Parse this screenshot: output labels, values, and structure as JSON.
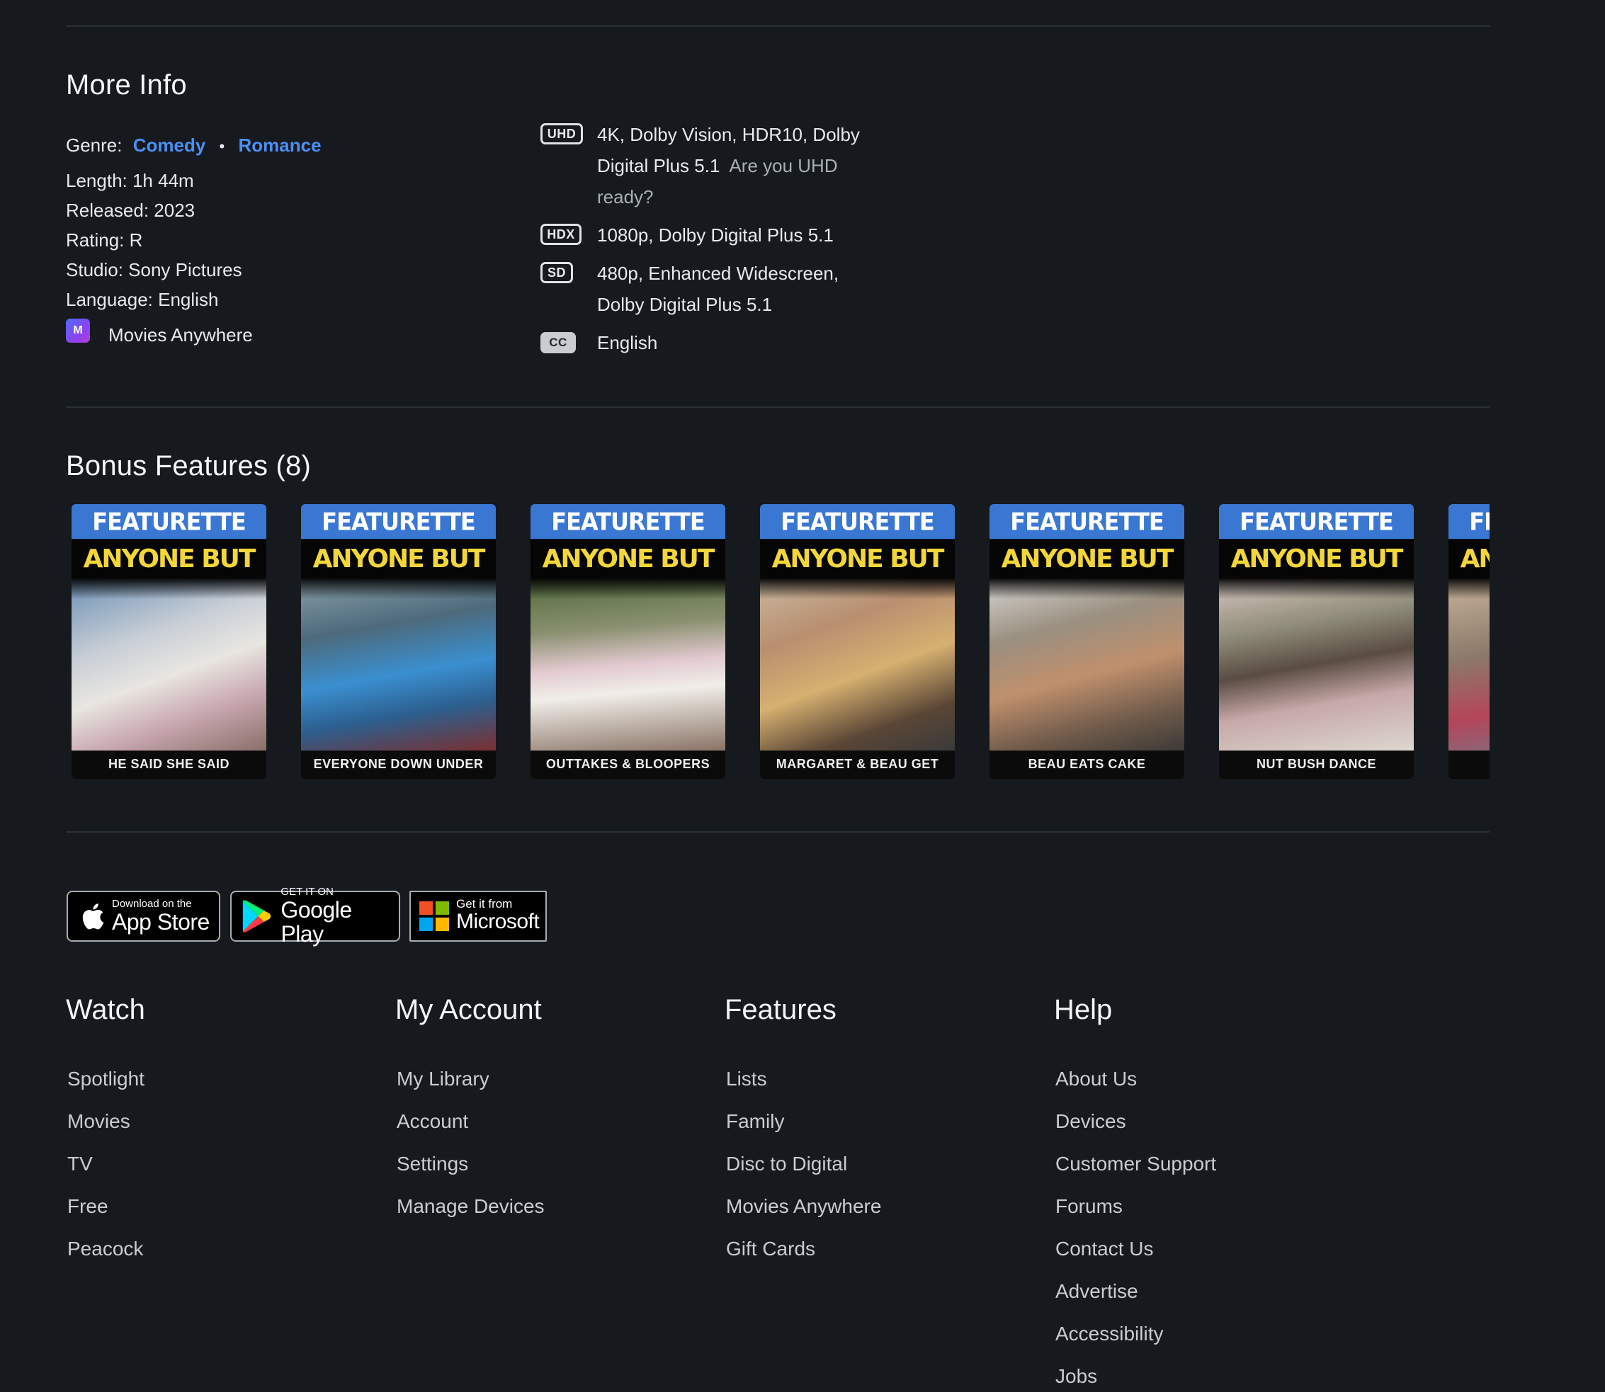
{
  "more_info": {
    "title": "More Info",
    "genre_label": "Genre:",
    "genres": [
      "Comedy",
      "Romance"
    ],
    "length": "Length: 1h 44m",
    "released": "Released: 2023",
    "rating": "Rating: R",
    "studio": "Studio: Sony Pictures",
    "language": "Language: English",
    "service_label": "Movies Anywhere",
    "service_icon_text": "M"
  },
  "formats": {
    "uhd_badge": "UHD",
    "uhd_line1": "4K, Dolby Vision, HDR10, Dolby",
    "uhd_line2": "Digital Plus 5.1",
    "uhd_link_a": "Are you UHD",
    "uhd_link_b": "ready?",
    "hdx_badge": "HDX",
    "hdx_text": "1080p, Dolby Digital Plus 5.1",
    "sd_badge": "SD",
    "sd_line1": "480p, Enhanced Widescreen,",
    "sd_line2": "Dolby Digital Plus 5.1",
    "cc_badge": "CC",
    "cc_text": "English"
  },
  "bonus": {
    "title": "Bonus Features (8)",
    "header_text": "FEATURETTE",
    "movie_text": "ANYONE BUT YOU",
    "cards": [
      {
        "caption": "HE SAID SHE SAID"
      },
      {
        "caption": "EVERYONE DOWN UNDER"
      },
      {
        "caption": "OUTTAKES & BLOOPERS"
      },
      {
        "caption": "MARGARET & BEAU GET READY"
      },
      {
        "caption": "BEAU EATS CAKE"
      },
      {
        "caption": "NUT BUSH DANCE"
      },
      {
        "caption": ""
      }
    ]
  },
  "stores": {
    "apple_small": "Download on the",
    "apple_big": "App Store",
    "google_small": "GET IT ON",
    "google_big": "Google Play",
    "ms_small": "Get it from",
    "ms_big": "Microsoft"
  },
  "footer": {
    "watch": {
      "title": "Watch",
      "items": [
        "Spotlight",
        "Movies",
        "TV",
        "Free",
        "Peacock"
      ]
    },
    "account": {
      "title": "My Account",
      "items": [
        "My Library",
        "Account",
        "Settings",
        "Manage Devices"
      ]
    },
    "features": {
      "title": "Features",
      "items": [
        "Lists",
        "Family",
        "Disc to Digital",
        "Movies Anywhere",
        "Gift Cards"
      ]
    },
    "help": {
      "title": "Help",
      "items": [
        "About Us",
        "Devices",
        "Customer Support",
        "Forums",
        "Contact Us",
        "Advertise",
        "Accessibility",
        "Jobs"
      ]
    }
  }
}
